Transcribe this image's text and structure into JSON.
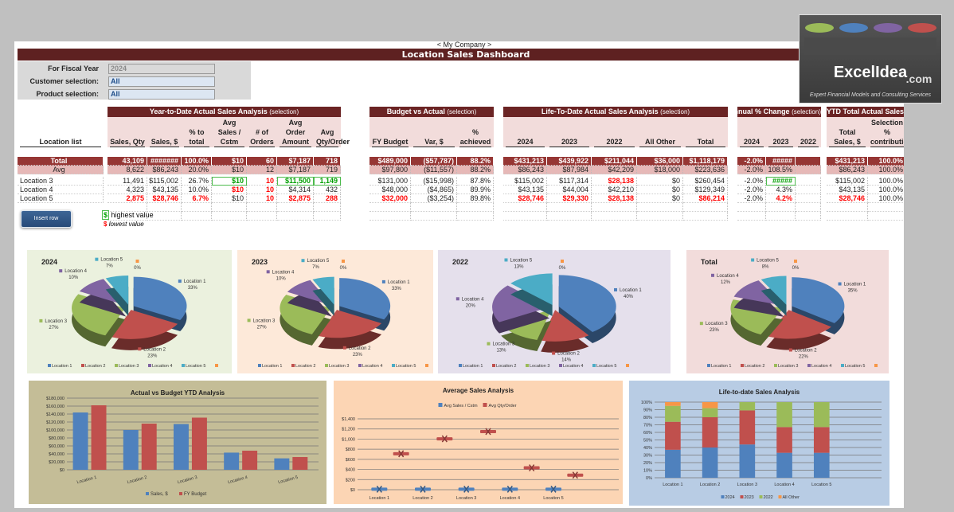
{
  "header": {
    "company": "< My Company >",
    "title": "Location Sales Dashboard"
  },
  "selections": [
    {
      "label": "For Fiscal Year",
      "value": "2024",
      "editable": false
    },
    {
      "label": "Customer selection:",
      "value": "All",
      "editable": true
    },
    {
      "label": "Product selection:",
      "value": "All",
      "editable": true
    }
  ],
  "sections": {
    "ytd": {
      "title": "Year-to-Date Actual Sales Analysis",
      "sub": "(selection)"
    },
    "bva": {
      "title": "Budget vs Actual",
      "sub": "(selection)"
    },
    "ltd": {
      "title": "Life-To-Date Actual Sales Analysis",
      "sub": "(selection)"
    },
    "apc": {
      "title": "Annual % Change",
      "sub": "(selection)"
    },
    "ytt": {
      "title": "YTD Total Actual Sales",
      "sub": ""
    }
  },
  "columns": {
    "location": "Location list",
    "qty": "Sales, Qty",
    "sales": "Sales, $",
    "pct": "% to total",
    "avgcstm": "Avg Sales / Cstm",
    "orders": "# of Orders",
    "avgorder": "Avg Order Amount",
    "avgqty": "Avg Qty/Order",
    "budget": "FY Budget",
    "var": "Var, $",
    "achieved": "% achieved",
    "y2024": "2024",
    "y2023": "2023",
    "y2022": "2022",
    "other": "All Other",
    "total": "Total",
    "c2024": "2024",
    "c2023": "2023",
    "c2022": "2022",
    "totsales": "Total Sales, $",
    "contrib": "Selection % contribution"
  },
  "rows": {
    "total": {
      "label": "Total",
      "qty": "43,109",
      "sales": "#######",
      "pct": "100.0%",
      "avgcstm": "$10",
      "orders": "60",
      "avgorder": "$7,187",
      "avgqty": "718",
      "budget": "$489,000",
      "var": "($57,787)",
      "achieved": "88.2%",
      "y2024": "$431,213",
      "y2023": "$439,922",
      "y2022": "$211,044",
      "other": "$36,000",
      "total": "$1,118,179",
      "c2024": "-2.0%",
      "c2023": "#####",
      "c2022": "",
      "totsales": "$431,213",
      "contrib": "100.0%"
    },
    "avg": {
      "label": "Avg",
      "qty": "8,622",
      "sales": "$86,243",
      "pct": "20.0%",
      "avgcstm": "$10",
      "orders": "12",
      "avgorder": "$7,187",
      "avgqty": "719",
      "budget": "$97,800",
      "var": "($11,557)",
      "achieved": "88.2%",
      "y2024": "$86,243",
      "y2023": "$87,984",
      "y2022": "$42,209",
      "other": "$18,000",
      "total": "$223,636",
      "c2024": "-2.0%",
      "c2023": "108.5%",
      "c2022": "",
      "totsales": "$86,243",
      "contrib": "100.0%"
    },
    "locations": [
      {
        "label": "Location 3",
        "qty": "11,491",
        "sales": "$115,002",
        "pct": "26.7%",
        "avgcstm": "$10",
        "orders": "10",
        "avgorder": "$11,500",
        "avgqty": "1,149",
        "budget": "$131,000",
        "var": "($15,998)",
        "achieved": "87.8%",
        "y2024": "$115,002",
        "y2023": "$117,314",
        "y2022": "$28,138",
        "other": "$0",
        "total": "$260,454",
        "c2024": "-2.0%",
        "c2023": "#####",
        "c2022": "",
        "totsales": "$115,002",
        "contrib": "100.0%"
      },
      {
        "label": "Location 4",
        "qty": "4,323",
        "sales": "$43,135",
        "pct": "10.0%",
        "avgcstm": "$10",
        "orders": "10",
        "avgorder": "$4,314",
        "avgqty": "432",
        "budget": "$48,000",
        "var": "($4,865)",
        "achieved": "89.9%",
        "y2024": "$43,135",
        "y2023": "$44,004",
        "y2022": "$42,210",
        "other": "$0",
        "total": "$129,349",
        "c2024": "-2.0%",
        "c2023": "4.3%",
        "c2022": "",
        "totsales": "$43,135",
        "contrib": "100.0%"
      },
      {
        "label": "Location 5",
        "qty": "2,875",
        "sales": "$28,746",
        "pct": "6.7%",
        "avgcstm": "$10",
        "orders": "10",
        "avgorder": "$2,875",
        "avgqty": "288",
        "budget": "$32,000",
        "var": "($3,254)",
        "achieved": "89.8%",
        "y2024": "$28,746",
        "y2023": "$29,330",
        "y2022": "$28,138",
        "other": "$0",
        "total": "$86,214",
        "c2024": "-2.0%",
        "c2023": "4.2%",
        "c2022": "",
        "totsales": "$28,746",
        "contrib": "100.0%"
      }
    ]
  },
  "buttons": {
    "insert_row": "Insert row"
  },
  "legend_notes": {
    "high_symbol": "$",
    "high": "highest value",
    "low_symbol": "$",
    "low": "lowest value"
  },
  "logo": {
    "brand": "ExcelIdea",
    "domain": ".com",
    "tagline": "Expert Financial Models and Consulting Services"
  },
  "colors": {
    "banner": "#5e2121",
    "section": "#6b2424",
    "total_row": "#963634",
    "avg_row": "#e6b8b7",
    "header_bg": "#f2dcdb",
    "highlight_high": "#00a000",
    "highlight_low": "#ff0000",
    "loc1": "#4f81bd",
    "loc2": "#c0504d",
    "loc3": "#9bbb59",
    "loc4": "#8064a2",
    "loc5": "#4bacc6",
    "other": "#f79646"
  },
  "chart_data": [
    {
      "type": "pie",
      "title": "2024",
      "bg": "#ebf1de",
      "categories": [
        "Location 1",
        "Location 2",
        "Location 3",
        "Location 4",
        "Location 5",
        ""
      ],
      "values": [
        33,
        23,
        27,
        10,
        7,
        0
      ],
      "labels": [
        "33%",
        "23%",
        "27%",
        "10%",
        "7%",
        "0%"
      ]
    },
    {
      "type": "pie",
      "title": "2023",
      "bg": "#fde9d9",
      "categories": [
        "Location 1",
        "Location 2",
        "Location 3",
        "Location 4",
        "Location 5",
        ""
      ],
      "values": [
        33,
        23,
        27,
        10,
        7,
        0
      ],
      "labels": [
        "33%",
        "23%",
        "27%",
        "10%",
        "7%",
        "0%"
      ]
    },
    {
      "type": "pie",
      "title": "2022",
      "bg": "#e5e0ec",
      "categories": [
        "Location 1",
        "Location 2",
        "Location 3",
        "Location 4",
        "Location 5",
        ""
      ],
      "values": [
        40,
        14,
        13,
        20,
        13,
        0
      ],
      "labels": [
        "40%",
        "14%",
        "13%",
        "20%",
        "13%",
        "0%"
      ]
    },
    {
      "type": "pie",
      "title": "Total",
      "bg": "#f2dcdb",
      "categories": [
        "Location 1",
        "Location 2",
        "Location 3",
        "Location 4",
        "Location 5",
        ""
      ],
      "values": [
        35,
        22,
        23,
        12,
        8,
        0
      ],
      "labels": [
        "35%",
        "22%",
        "23%",
        "12%",
        "8%",
        "0%"
      ]
    },
    {
      "type": "bar",
      "title": "Actual vs Budget YTD Analysis",
      "bg": "#c4bd97",
      "categories": [
        "Location 1",
        "Location 2",
        "Location 3",
        "Location 4",
        "Location 5"
      ],
      "series": [
        {
          "name": "Sales, $",
          "values": [
            144000,
            100000,
            115002,
            43135,
            28746
          ]
        },
        {
          "name": "FY Budget",
          "values": [
            162000,
            116000,
            131000,
            48000,
            32000
          ]
        }
      ],
      "ylim": [
        0,
        180000
      ],
      "yticks": [
        "$0",
        "$20,000",
        "$40,000",
        "$60,000",
        "$80,000",
        "$100,000",
        "$120,000",
        "$140,000",
        "$160,000",
        "$180,000"
      ],
      "legend": "bottom"
    },
    {
      "type": "scatter",
      "title": "Average Sales Analysis",
      "bg": "#fcd5b4",
      "categories": [
        "Location 1",
        "Location 2",
        "Location 3",
        "Location 4",
        "Location 5"
      ],
      "series": [
        {
          "name": "Avg Sales / Cstm",
          "values": [
            10,
            10,
            10,
            10,
            10
          ]
        },
        {
          "name": "Avg Qty/Order",
          "values": [
            710,
            1005,
            1149,
            432,
            288
          ]
        }
      ],
      "ylim": [
        0,
        1400
      ],
      "yticks": [
        "$0",
        "$200",
        "$400",
        "$600",
        "$800",
        "$1,000",
        "$1,200",
        "$1,400"
      ],
      "legend": "top"
    },
    {
      "type": "bar",
      "stacked": true,
      "title": "Life-to-date Sales Analysis",
      "bg": "#b8cce4",
      "categories": [
        "Location 1",
        "Location 2",
        "Location 3",
        "Location 4",
        "Location 5"
      ],
      "series": [
        {
          "name": "2024",
          "values": [
            37,
            40,
            44,
            33,
            33
          ]
        },
        {
          "name": "2023",
          "values": [
            37,
            40,
            45,
            34,
            34
          ]
        },
        {
          "name": "2022",
          "values": [
            21,
            12,
            11,
            33,
            33
          ]
        },
        {
          "name": "All Other",
          "values": [
            5,
            8,
            0,
            0,
            0
          ]
        }
      ],
      "ylim": [
        0,
        100
      ],
      "yticks": [
        "0%",
        "10%",
        "20%",
        "30%",
        "40%",
        "50%",
        "60%",
        "70%",
        "80%",
        "90%",
        "100%"
      ],
      "legend": "bottom"
    }
  ]
}
